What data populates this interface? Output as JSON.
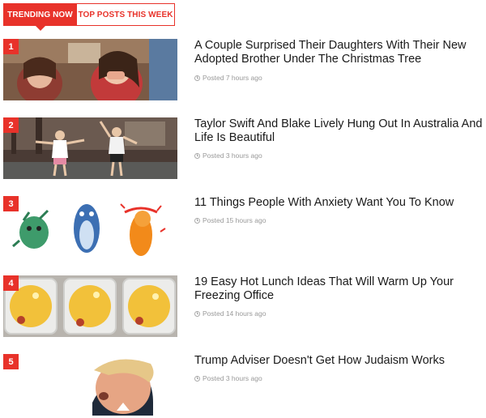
{
  "tabs": [
    {
      "label": "TRENDING NOW",
      "active": true
    },
    {
      "label": "TOP POSTS THIS WEEK",
      "active": false
    }
  ],
  "accent_color": "#e8322a",
  "articles": [
    {
      "rank": "1",
      "title": "A Couple Surprised Their Daughters With Their New Adopted Brother Under The Christmas Tree",
      "posted": "Posted 7 hours ago"
    },
    {
      "rank": "2",
      "title": "Taylor Swift And Blake Lively Hung Out In Australia And Life Is Beautiful",
      "posted": "Posted 3 hours ago"
    },
    {
      "rank": "3",
      "title": "11 Things People With Anxiety Want You To Know",
      "posted": "Posted 15 hours ago"
    },
    {
      "rank": "4",
      "title": "19 Easy Hot Lunch Ideas That Will Warm Up Your Freezing Office",
      "posted": "Posted 14 hours ago"
    },
    {
      "rank": "5",
      "title": "Trump Adviser Doesn't Get How Judaism Works",
      "posted": "Posted 3 hours ago"
    }
  ]
}
